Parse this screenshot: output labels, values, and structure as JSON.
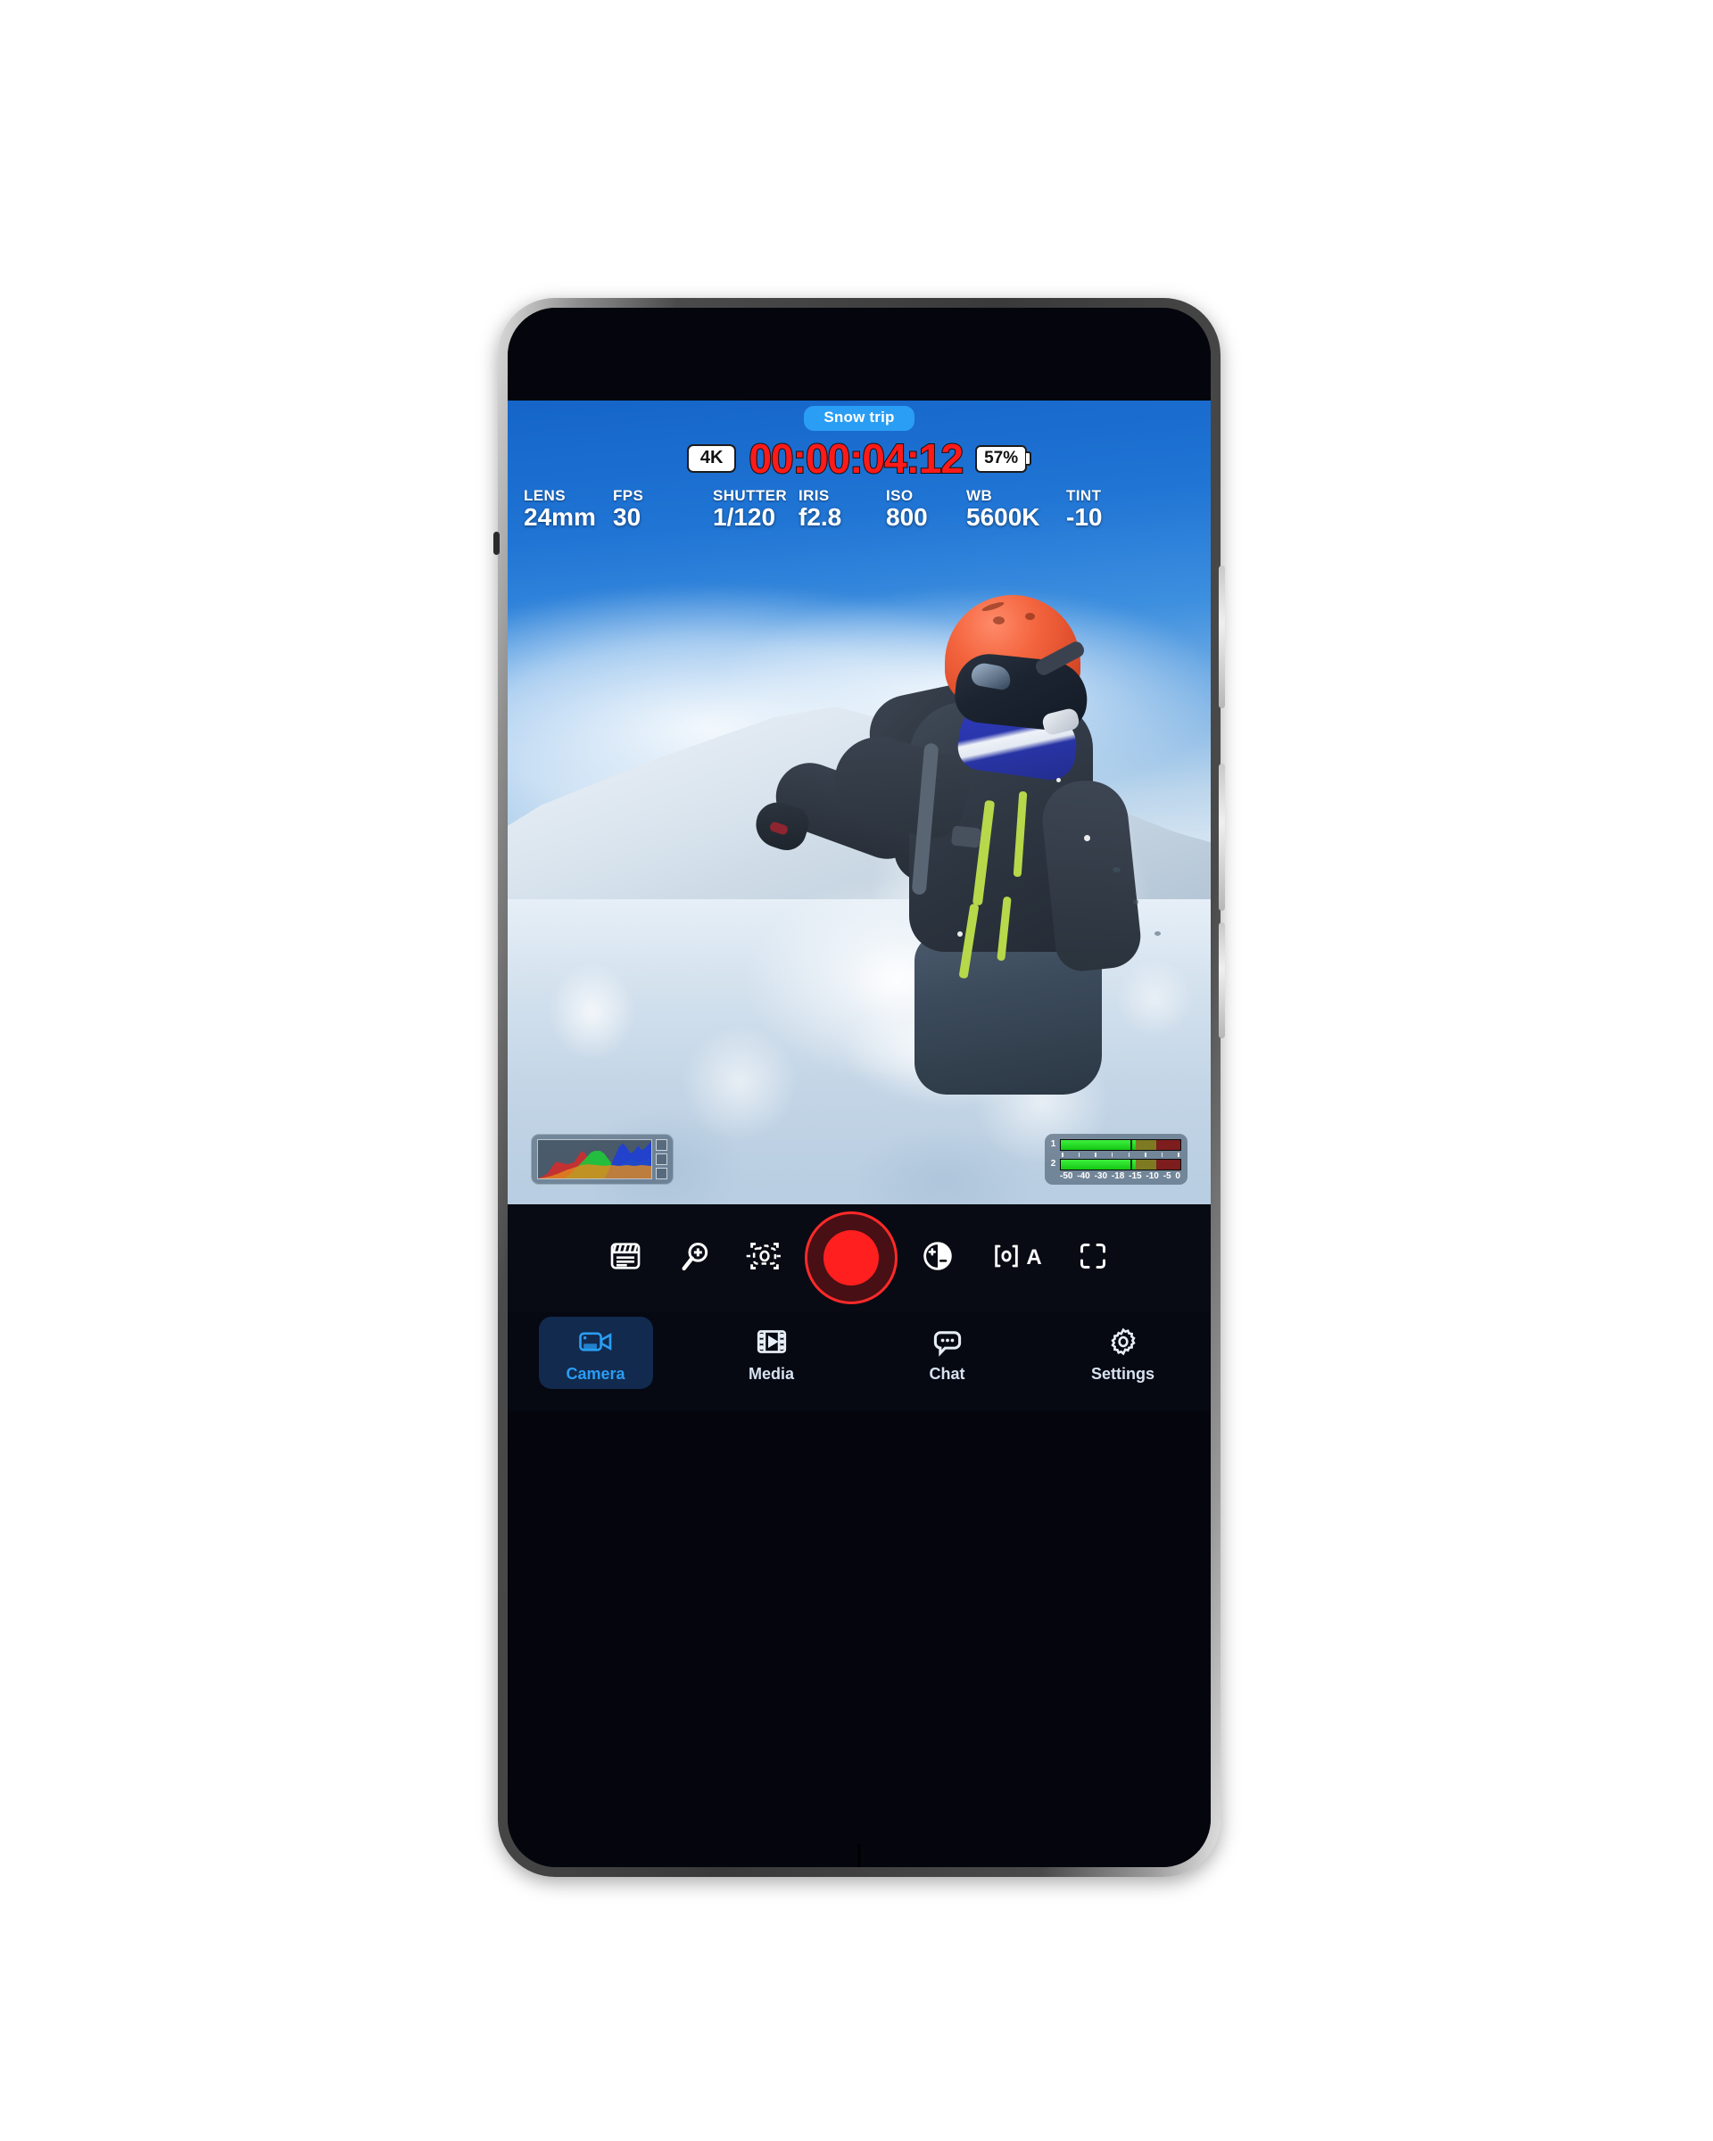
{
  "app": {
    "project_badge": "Snow trip",
    "resolution_badge": "4K",
    "timecode": "00:00:04:12",
    "battery": "57%"
  },
  "camera_params": [
    {
      "label": "LENS",
      "value": "24mm"
    },
    {
      "label": "FPS",
      "value": "30"
    },
    {
      "label": "SHUTTER",
      "value": "1/120"
    },
    {
      "label": "IRIS",
      "value": "f2.8"
    },
    {
      "label": "ISO",
      "value": "800"
    },
    {
      "label": "WB",
      "value": "5600K"
    },
    {
      "label": "TINT",
      "value": "-10"
    }
  ],
  "scopes": {
    "histogram": {
      "name": "RGB histogram",
      "channels": [
        "red",
        "green",
        "blue"
      ]
    },
    "audio_meters": {
      "channels": [
        "1",
        "2"
      ],
      "scale_labels": [
        "-50",
        "-40",
        "-30",
        "-18",
        "-15",
        "-10",
        "-5",
        "0"
      ],
      "level_db": "-18"
    }
  },
  "controls": [
    {
      "name": "slate-icon",
      "label": "Slate"
    },
    {
      "name": "zoom-in-icon",
      "label": "Zoom"
    },
    {
      "name": "camera-focus-icon",
      "label": "Focus"
    },
    {
      "name": "record-button",
      "label": "Record"
    },
    {
      "name": "exposure-icon",
      "label": "Exposure"
    },
    {
      "name": "auto-focus-icon",
      "label": "Auto focus",
      "badge": "A"
    },
    {
      "name": "framing-icon",
      "label": "Framing"
    }
  ],
  "bottom_nav": {
    "active": "Camera",
    "items": [
      {
        "label": "Camera",
        "icon": "video-camera-icon"
      },
      {
        "label": "Media",
        "icon": "film-play-icon"
      },
      {
        "label": "Chat",
        "icon": "chat-bubble-icon"
      },
      {
        "label": "Settings",
        "icon": "gear-icon"
      }
    ]
  },
  "colors": {
    "accent_blue": "#2a9df4",
    "record_red": "#ff1f1f",
    "timecode_red": "#ff1a1a",
    "nav_bg": "#060812",
    "control_bg": "#090b14"
  }
}
